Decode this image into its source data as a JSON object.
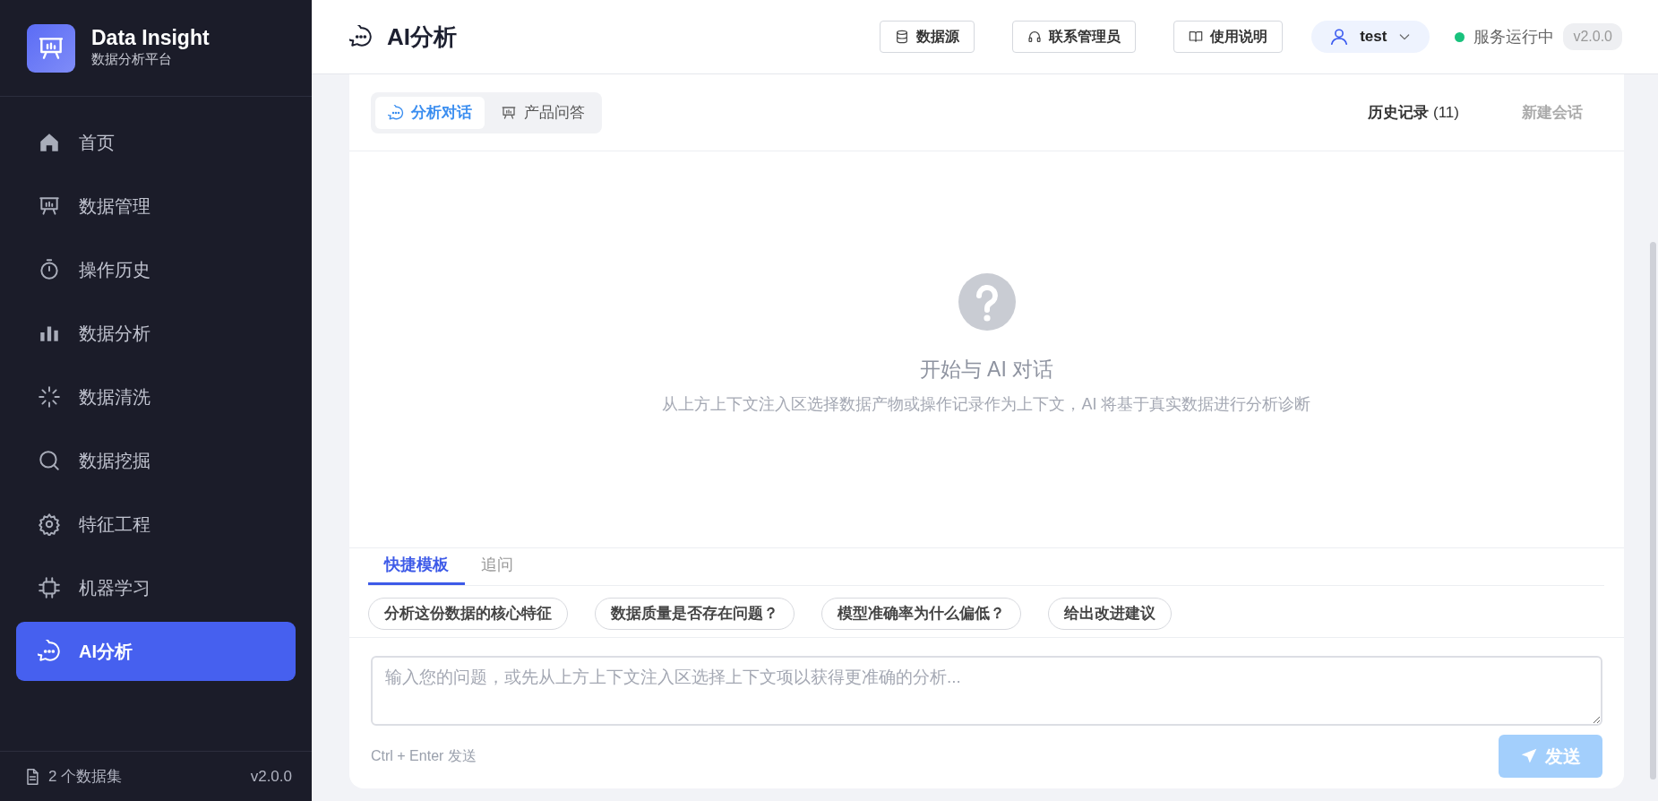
{
  "sidebar": {
    "brand": "Data Insight",
    "subtitle": "数据分析平台",
    "items": [
      {
        "label": "首页",
        "selected": false
      },
      {
        "label": "数据管理",
        "selected": false
      },
      {
        "label": "操作历史",
        "selected": false
      },
      {
        "label": "数据分析",
        "selected": false
      },
      {
        "label": "数据清洗",
        "selected": false
      },
      {
        "label": "数据挖掘",
        "selected": false
      },
      {
        "label": "特征工程",
        "selected": false
      },
      {
        "label": "机器学习",
        "selected": false
      },
      {
        "label": "AI分析",
        "selected": true
      }
    ],
    "footer": {
      "datasets": "2 个数据集",
      "version": "v2.0.0"
    }
  },
  "header": {
    "title": "AI分析",
    "buttons": [
      "数据源",
      "联系管理员",
      "使用说明"
    ],
    "user": "test",
    "status": {
      "label": "服务运行中",
      "running": true
    },
    "version": "v2.0.0"
  },
  "chat": {
    "tabs": [
      {
        "label": "分析对话",
        "selected": true
      },
      {
        "label": "产品问答",
        "selected": false
      }
    ],
    "history": "**历史记录** (11)",
    "new_session": {
      "label": "新建会话",
      "disabled": true
    },
    "empty": {
      "title": "开始与 AI 对话",
      "subtitle": "从上方上下文注入区选择数据产物或操作记录作为上下文，AI 将基于真实数据进行分析诊断"
    },
    "bottom_tabs": [
      {
        "label": "快捷模板",
        "selected": true
      },
      {
        "label": "追问",
        "selected": false
      }
    ],
    "templates": [
      "分析这份数据的核心特征",
      "数据质量是否存在问题？",
      "模型准确率为什么偏低？",
      "给出改进建议"
    ],
    "input": {
      "placeholder": "输入您的问题，或先从上方上下文注入区选择上下文项以获得更准确的分析..."
    },
    "hint": "Ctrl + Enter 发送",
    "send": {
      "label": "发送",
      "disabled": true
    }
  }
}
